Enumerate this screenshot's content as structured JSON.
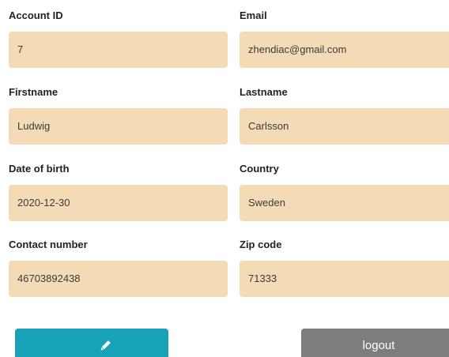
{
  "form": {
    "account_id": {
      "label": "Account ID",
      "value": "7"
    },
    "email": {
      "label": "Email",
      "value": "zhendiac@gmail.com"
    },
    "firstname": {
      "label": "Firstname",
      "value": "Ludwig"
    },
    "lastname": {
      "label": "Lastname",
      "value": "Carlsson"
    },
    "date_of_birth": {
      "label": "Date of birth",
      "value": "2020-12-30"
    },
    "country": {
      "label": "Country",
      "value": "Sweden"
    },
    "contact_number": {
      "label": "Contact number",
      "value": "46703892438"
    },
    "zip_code": {
      "label": "Zip code",
      "value": "71333"
    }
  },
  "actions": {
    "edit_icon": "pencil-icon",
    "edit_color": "#17a2b8",
    "logout_label": "logout",
    "logout_color": "#7d7d7d"
  },
  "colors": {
    "field_background": "#f3dcb5"
  }
}
